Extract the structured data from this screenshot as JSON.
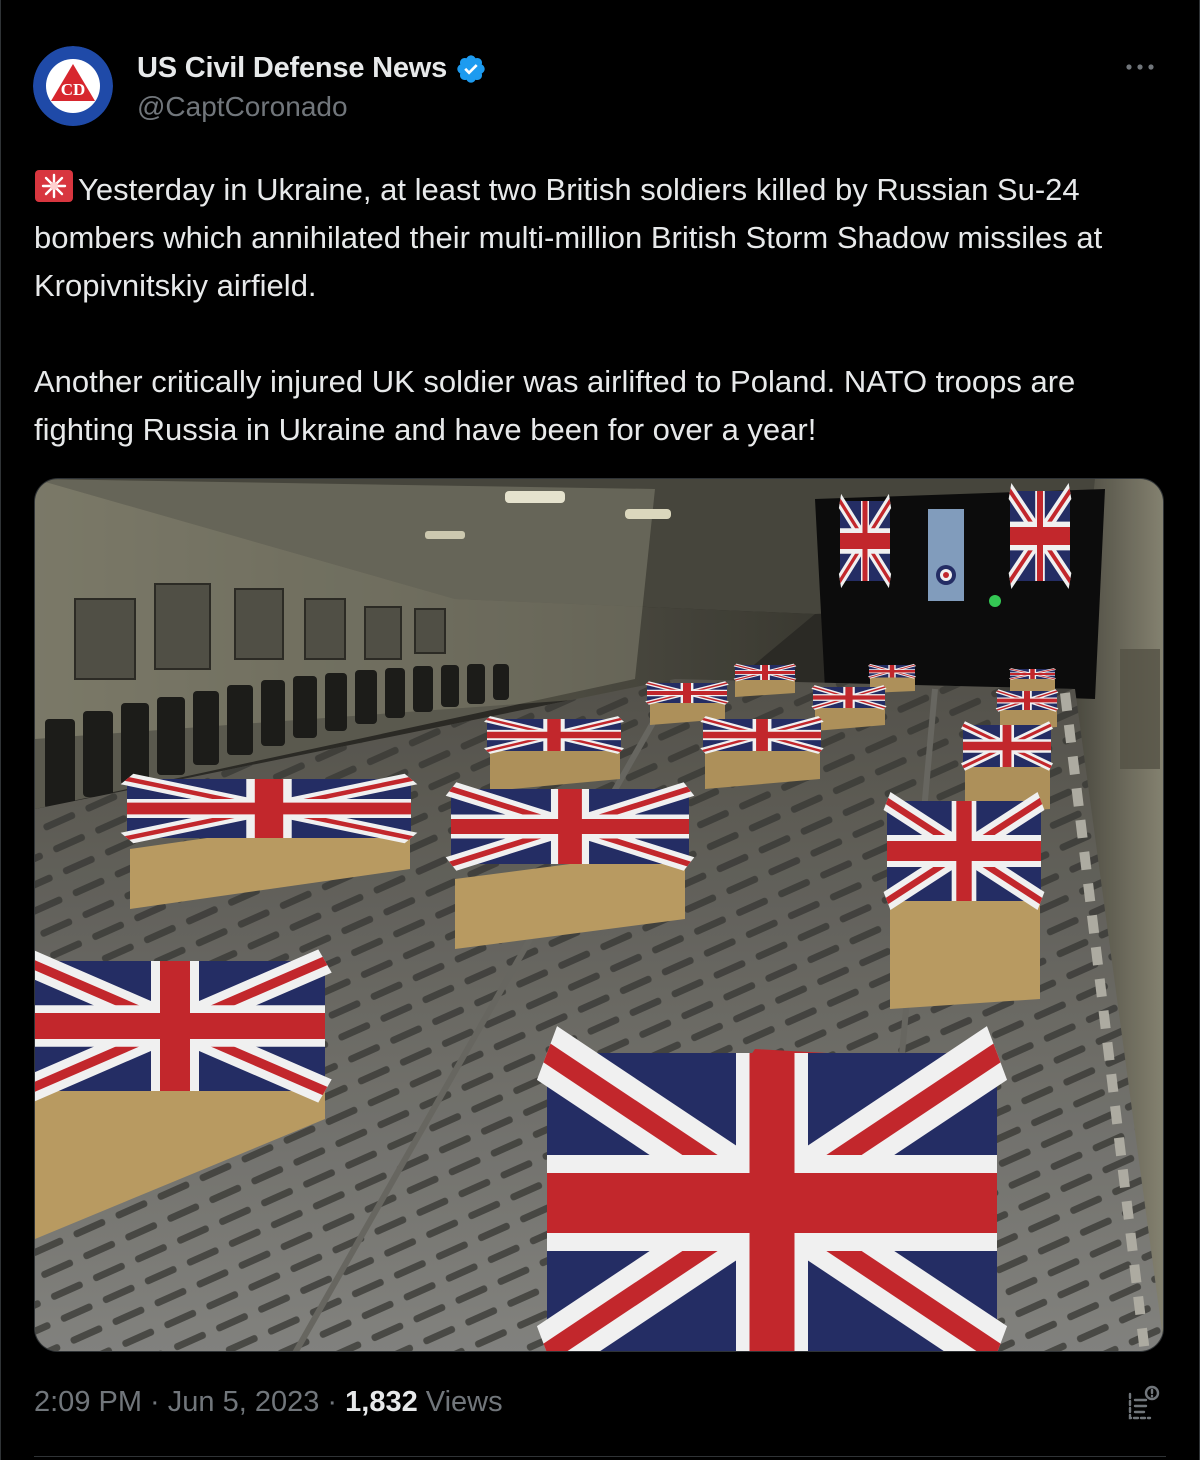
{
  "tweet": {
    "author": {
      "display_name": "US Civil Defense News",
      "handle": "@CaptCoronado",
      "avatar_text": "CD",
      "verified": true
    },
    "emoji": "siren-icon",
    "paragraph1": "Yesterday in Ukraine, at least two British soldiers killed by Russian Su-24 bombers which annihilated their multi-million British Storm Shadow missiles  at Kropivnitskiy airfield.",
    "paragraph2": "Another critically injured UK soldier was airlifted to Poland. NATO troops are fighting Russia in Ukraine and have been for over a year!",
    "time": "2:09 PM",
    "sep1": " · ",
    "date": "Jun 5, 2023",
    "sep2": " · ",
    "views_count": "1,832",
    "views_label": " Views"
  },
  "colors": {
    "background": "#000000",
    "text": "#e7e9ea",
    "secondary": "#71767b",
    "verified_blue": "#1d9bf0",
    "union_red": "#cf2a2f",
    "union_blue": "#27306b"
  },
  "icons": [
    "more-icon",
    "verified-badge-icon",
    "siren-icon",
    "analytics-icon"
  ]
}
